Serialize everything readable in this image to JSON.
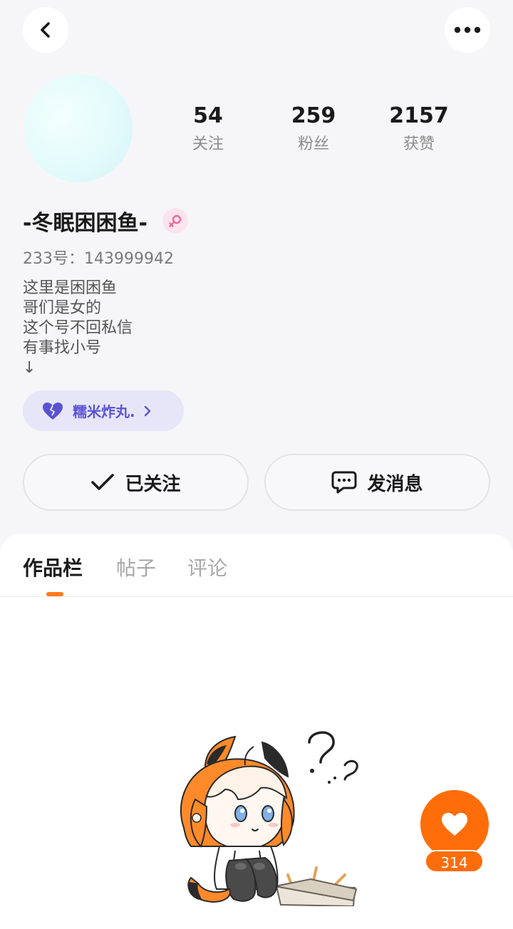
{
  "header": {
    "back_icon": "chevron-left-icon",
    "more_icon": "more-horizontal-icon"
  },
  "profile": {
    "stats": [
      {
        "value": "54",
        "label": "关注"
      },
      {
        "value": "259",
        "label": "粉丝"
      },
      {
        "value": "2157",
        "label": "获赞"
      }
    ],
    "name": "-冬眠困困鱼-",
    "gender_icon": "female-icon",
    "uid": "233号：143999942",
    "bio": [
      "这里是困困鱼",
      "哥们是女的",
      "这个号不回私信",
      "有事找小号",
      "↓"
    ],
    "group": {
      "label": "糯米炸丸.",
      "icon": "broken-heart-icon"
    },
    "follow_label": "已关注",
    "message_label": "发消息"
  },
  "tabs": [
    {
      "label": "作品栏",
      "active": true
    },
    {
      "label": "帖子",
      "active": false
    },
    {
      "label": "评论",
      "active": false
    }
  ],
  "fab": {
    "count": "314",
    "icon": "heart-icon"
  },
  "colors": {
    "accent": "#ff6d0a",
    "group_text": "#5a52d3",
    "group_bg": "#e7e6f9"
  }
}
